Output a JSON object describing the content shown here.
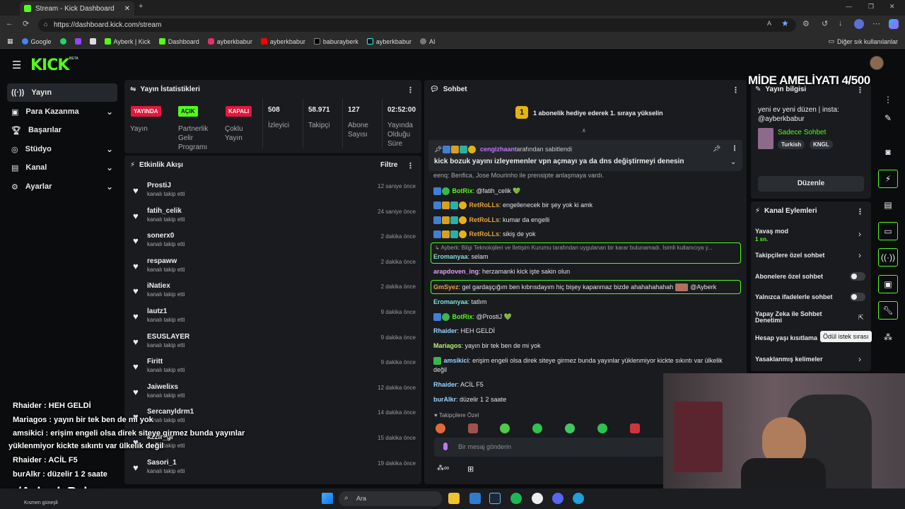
{
  "browser": {
    "tab_title": "Stream - Kick Dashboard",
    "url": "https://dashboard.kick.com/stream",
    "bookmarks": [
      "Google",
      "Ayberk | Kick",
      "Dashboard",
      "ayberkbabur",
      "ayberkbabur",
      "baburayberk",
      "ayberkbabur",
      "AI"
    ],
    "other_bookmarks": "Diğer sık kullanılanlar"
  },
  "kick": {
    "logo": "KICK",
    "beta": "BETA"
  },
  "sidebar": {
    "items": [
      {
        "label": "Yayın",
        "icon": "broadcast-icon"
      },
      {
        "label": "Para Kazanma",
        "icon": "money-icon"
      },
      {
        "label": "Başarılar",
        "icon": "trophy-icon"
      },
      {
        "label": "Stüdyo",
        "icon": "studio-icon"
      },
      {
        "label": "Kanal",
        "icon": "channel-icon"
      },
      {
        "label": "Ayarlar",
        "icon": "gear-icon"
      }
    ]
  },
  "stats": {
    "title": "Yayın İstatistikleri",
    "badges": [
      {
        "badge": "YAYINDA",
        "label": "Yayın",
        "color": "#e5163b"
      },
      {
        "badge": "AÇIK",
        "label": "Partnerlik Gelir Programı",
        "color": "#53fc18"
      },
      {
        "badge": "KAPALI",
        "label": "Çoklu Yayın",
        "color": "#e5163b"
      }
    ],
    "numbers": [
      {
        "value": "508",
        "label": "İzleyici"
      },
      {
        "value": "58.971",
        "label": "Takipçi"
      },
      {
        "value": "127",
        "label": "Abone Sayısı"
      },
      {
        "value": "02:52:00",
        "label": "Yayında Olduğu Süre"
      }
    ]
  },
  "activity": {
    "title": "Etkinlik Akışı",
    "filter": "Filtre",
    "sub": "kanalı takip etti",
    "rows": [
      {
        "name": "ProstiJ",
        "time": "12 saniye önce"
      },
      {
        "name": "fatih_celik",
        "time": "24 saniye önce"
      },
      {
        "name": "sonerx0",
        "time": "2 dakika önce"
      },
      {
        "name": "respaww",
        "time": "2 dakika önce"
      },
      {
        "name": "iNatiex",
        "time": "2 dakika önce"
      },
      {
        "name": "lautz1",
        "time": "9 dakika önce"
      },
      {
        "name": "ESUSLAYER",
        "time": "9 dakika önce"
      },
      {
        "name": "Firitt",
        "time": "9 dakika önce"
      },
      {
        "name": "Jaiwelixs",
        "time": "12 dakika önce"
      },
      {
        "name": "Sercanyldrm1",
        "time": "14 dakika önce"
      },
      {
        "name": "kzzlr_gr",
        "time": "15 dakika önce"
      },
      {
        "name": "Sasori_1",
        "time": "19 dakika önce"
      }
    ]
  },
  "chat": {
    "title": "Sohbet",
    "gift_banner": "1 abonelik hediye ederek 1. sıraya yükselin",
    "gift_number": "1",
    "pinned_user": "cengizhaan",
    "pinned_by": "tarafından sabitlendi",
    "pinned_text": "kick bozuk yayını izleyemenler vpn açmayı ya da dns değiştirmeyi denesin",
    "partial_top": "eenq: Benfica, Jose Mourinho ile prensipte anlaşmaya vardı.",
    "messages": [
      {
        "user": "BotRix",
        "text": "@fatih_celik 💚",
        "color": "#53fc18"
      },
      {
        "user": "RetRoLLs",
        "text": "engellenecek bir şey yok ki amk",
        "color": "#e8a33d"
      },
      {
        "user": "RetRoLLs",
        "text": "kumar da engelli",
        "color": "#e8a33d"
      },
      {
        "user": "RetRoLLs",
        "text": "sikiş de yok",
        "color": "#e8a33d"
      }
    ],
    "reply_quote": "↳ Ayberk: Bilgi Teknolojileri ve İletişim Kurumu tarafından uygulanan bir karar bulunamadı. İsimli kullanıcıya y...",
    "reply_user": "Eromanyaa",
    "reply_text": "selam",
    "m2_user": "arapdoven_ing",
    "m2_text": "herzamanki kick işte sakin olun",
    "m3_user": "GmSyez",
    "m3_text": "gel gardaşçığım ben kıbrısdayım hiç bişey kapanmaz bizde ahahahahahah",
    "m3_mention": "@Ayberk",
    "m4_user": "Eromanyaa",
    "m4_text": "tatlım",
    "m5_user": "BotRix",
    "m5_text": "@ProstiJ 💚",
    "m6_user": "Rhaider",
    "m6_text": "HEH GELDİ",
    "m7_user": "Mariagos",
    "m7_text": "yayın bir tek ben de mi yok",
    "m8_user": "amsikici",
    "m8_text": "erişim engeli olsa direk siteye girmez bunda yayınlar yüklenmiyor kickte sıkıntı var ülkelik değil",
    "m9_user": "Rhaider",
    "m9_text": "ACİL F5",
    "m10_user": "burAlkr",
    "m10_text": "düzelir 1 2 saate",
    "followers_only": "Takipçilere Özel",
    "input_placeholder": "Bir mesaj gönderin"
  },
  "stream_info": {
    "title": "Yayın bilgisi",
    "description": "yeni ev yeni düzen | insta: @ayberkbabur",
    "category": "Sadece Sohbet",
    "tags": [
      "Turkish",
      "KNGL"
    ],
    "edit_button": "Düzenle"
  },
  "channel_actions": {
    "title": "Kanal Eylemleri",
    "items": [
      {
        "label": "Yavaş mod",
        "sub": "1 sn.",
        "kind": "chevron"
      },
      {
        "label": "Takipçilere özel sohbet",
        "kind": "chevron"
      },
      {
        "label": "Abonelere özel sohbet",
        "kind": "toggle"
      },
      {
        "label": "Yalnızca ifadelerle sohbet",
        "kind": "toggle"
      },
      {
        "label": "Yapay Zeka ile Sohbet Denetimi",
        "kind": "external"
      },
      {
        "label": "Hesap yaşı kısıtlama",
        "kind": "none"
      },
      {
        "label": "Yasaklanmış kelimeler",
        "kind": "chevron"
      }
    ],
    "tooltip": "Ödül istek sırası"
  },
  "overlay": {
    "title": "MİDE AMELİYATI 4/500",
    "chat_lines": [
      {
        "user": "Rhaider",
        "text": "HEH GELDİ"
      },
      {
        "user": "Mariagos",
        "text": "yayın bir tek ben de mi yok"
      },
      {
        "user": "amsikici",
        "text": "erişim engeli olsa direk siteye girmez bunda yayınlar"
      },
      {
        "user": "",
        "text": "yüklenmiyor kickte sıkıntı var ülkelik değil"
      },
      {
        "user": "Rhaider",
        "text": "ACİL F5"
      },
      {
        "user": "burAlkr",
        "text": "düzelir 1 2 saate"
      }
    ],
    "watermark": "om/Ayberk Babur",
    "weather": "Kısmen güneşli"
  },
  "taskbar": {
    "search": "Ara"
  }
}
